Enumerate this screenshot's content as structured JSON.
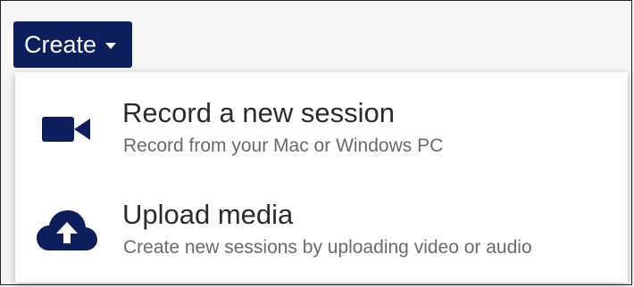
{
  "toolbar": {
    "create_label": "Create"
  },
  "menu": {
    "items": [
      {
        "title": "Record a new session",
        "subtitle": "Record from your Mac or Windows PC",
        "icon": "video-camera-icon"
      },
      {
        "title": "Upload media",
        "subtitle": "Create new sessions by uploading video or audio",
        "icon": "cloud-upload-icon"
      }
    ]
  },
  "colors": {
    "brand_navy": "#0c1f5c",
    "title_text": "#2b2b2b",
    "subtitle_text": "#6a6a6a",
    "menu_background": "#ffffff"
  }
}
